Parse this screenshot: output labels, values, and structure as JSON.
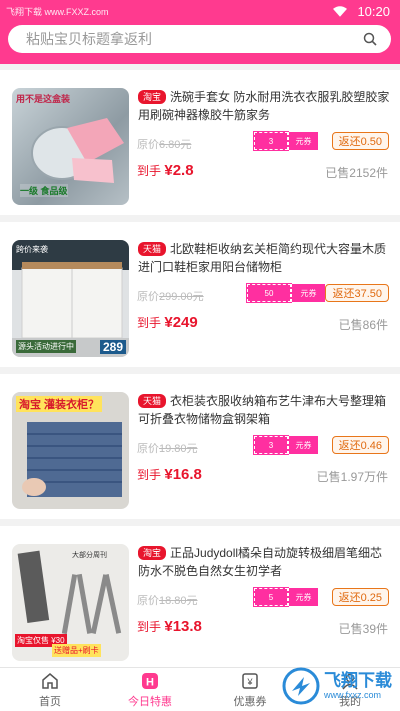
{
  "status": {
    "watermark": "飞翔下载 www.FXXZ.com",
    "time": "10:20"
  },
  "search": {
    "placeholder": "粘贴宝贝标题拿返利"
  },
  "products": [
    {
      "platform": "淘宝",
      "title": "洗碗手套女 防水耐用洗衣衣服乳胶塑胶家用刷碗神器橡胶牛筋家务",
      "orig_label": "原价",
      "orig_price": "6.80元",
      "coupon_value": "3",
      "coupon_unit": "元券",
      "rebate": "返还0.50",
      "final_label": "到手",
      "final_price": "¥2.8",
      "sold": "已售2152件"
    },
    {
      "platform": "天猫",
      "title": "北欧鞋柜收纳玄关柜简约现代大容量木质进门口鞋柜家用阳台储物柜",
      "orig_label": "原价",
      "orig_price": "299.00元",
      "coupon_value": "50",
      "coupon_unit": "元券",
      "rebate": "返还37.50",
      "final_label": "到手",
      "final_price": "¥249",
      "sold": "已售86件"
    },
    {
      "platform": "天猫",
      "title": "衣柜装衣服收纳箱布艺牛津布大号整理箱可折叠衣物储物盒钢架箱",
      "orig_label": "原价",
      "orig_price": "19.80元",
      "coupon_value": "3",
      "coupon_unit": "元券",
      "rebate": "返还0.46",
      "final_label": "到手",
      "final_price": "¥16.8",
      "sold": "已售1.97万件"
    },
    {
      "platform": "淘宝",
      "title": "正品Judydoll橘朵自动旋转极细眉笔细芯防水不脱色自然女生初学者",
      "orig_label": "原价",
      "orig_price": "18.80元",
      "coupon_value": "5",
      "coupon_unit": "元券",
      "rebate": "返还0.25",
      "final_label": "到手",
      "final_price": "¥13.8",
      "sold": "已售39件"
    }
  ],
  "thumb_text": {
    "p1_top": "用不是这盒装",
    "p1_bottom": "一级 食品级",
    "p2_top": "跨价来袭",
    "p2_bottom": "源头活动进行中",
    "p2_price": "289",
    "p3_top": "淘宝 灌装衣柜？",
    "p4_brand": "大部分周刊",
    "p4_badge": "淘宝仅售 ¥30",
    "p4_promo": "送赠品+刷卡"
  },
  "tabs": [
    {
      "label": "首页",
      "icon": "home-icon"
    },
    {
      "label": "今日特惠",
      "icon": "h-icon"
    },
    {
      "label": "优惠券",
      "icon": "coupon-icon"
    },
    {
      "label": "我的",
      "icon": "user-icon"
    }
  ],
  "brand": {
    "name": "飞翔下载",
    "url": "www.fxxz.com"
  },
  "colors": {
    "accent": "#ff3a8f",
    "price": "#e8152d",
    "rebate": "#e06a10",
    "coupon": "#ff2fa0"
  }
}
